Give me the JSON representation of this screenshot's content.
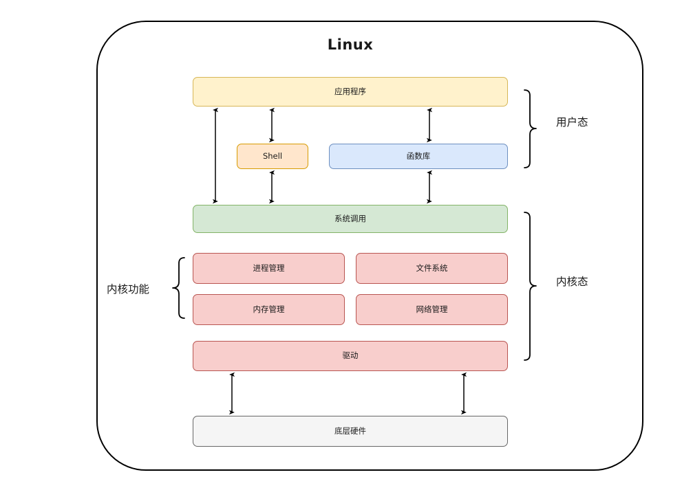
{
  "diagram": {
    "title": "Linux",
    "frame_border_color": "#000000",
    "nodes": [
      {
        "id": "app",
        "label": "应用程序",
        "fill": "#fff2cc",
        "stroke": "#d6b656"
      },
      {
        "id": "shell",
        "label": "Shell",
        "fill": "#ffe6cc",
        "stroke": "#d79b00"
      },
      {
        "id": "lib",
        "label": "函数库",
        "fill": "#dae8fc",
        "stroke": "#6c8ebf"
      },
      {
        "id": "sys",
        "label": "系统调用",
        "fill": "#d5e8d4",
        "stroke": "#82b366"
      },
      {
        "id": "proc",
        "label": "进程管理",
        "fill": "#f8cecc",
        "stroke": "#b85450"
      },
      {
        "id": "fs",
        "label": "文件系统",
        "fill": "#f8cecc",
        "stroke": "#b85450"
      },
      {
        "id": "mem",
        "label": "内存管理",
        "fill": "#f8cecc",
        "stroke": "#b85450"
      },
      {
        "id": "net",
        "label": "网络管理",
        "fill": "#f8cecc",
        "stroke": "#b85450"
      },
      {
        "id": "drv",
        "label": "驱动",
        "fill": "#f8cecc",
        "stroke": "#b85450"
      },
      {
        "id": "hw",
        "label": "底层硬件",
        "fill": "#f5f5f5",
        "stroke": "#666666"
      }
    ],
    "annotations": {
      "user_mode": "用户态",
      "kernel_mode": "内核态",
      "kernel_functions": "内核功能"
    },
    "connectors": [
      {
        "from": "app",
        "to": "sys",
        "style": "double-arrow"
      },
      {
        "from": "app",
        "to": "shell",
        "style": "double-arrow"
      },
      {
        "from": "shell",
        "to": "sys",
        "style": "double-arrow"
      },
      {
        "from": "app",
        "to": "lib",
        "style": "double-arrow"
      },
      {
        "from": "lib",
        "to": "sys",
        "style": "double-arrow"
      },
      {
        "from": "drv",
        "to": "hw",
        "style": "double-arrow"
      },
      {
        "from": "drv",
        "to": "hw",
        "style": "double-arrow"
      }
    ]
  }
}
